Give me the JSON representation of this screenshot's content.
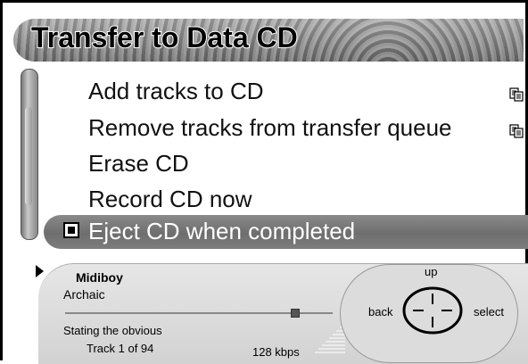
{
  "header": {
    "title": "Transfer to Data CD"
  },
  "menu": {
    "items": [
      {
        "label": "Add tracks to CD",
        "icon": "copy-icon"
      },
      {
        "label": "Remove tracks from transfer queue",
        "icon": "copy-icon"
      },
      {
        "label": "Erase CD"
      },
      {
        "label": "Record CD now"
      }
    ],
    "selected": {
      "label": "Eject CD when completed",
      "checked": true
    }
  },
  "player": {
    "artist": "Midiboy",
    "album": "Archaic",
    "song": "Stating the obvious",
    "track": "Track 1 of 94",
    "bitrate": "128 kbps",
    "progress": 0.86,
    "state": "playing"
  },
  "nav": {
    "up": "up",
    "back": "back",
    "select": "select"
  },
  "colors": {
    "selected_row": "#7a7a7a",
    "title_bar": "#888888",
    "panel": "#d9d9d9"
  }
}
